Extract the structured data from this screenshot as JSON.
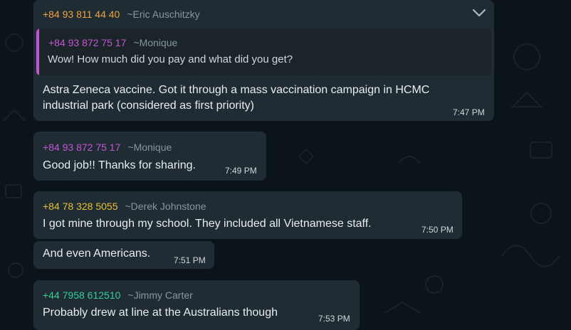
{
  "colors": {
    "background": "#0b141a",
    "bubble": "#202c33",
    "orange": "#f0a23c",
    "purple": "#c455d4",
    "yellow": "#e6c12e",
    "teal": "#35cd96",
    "muted": "#8696a0"
  },
  "messages": [
    {
      "phone": "+84 93 811 44 40",
      "name": "~Eric Auschitzky",
      "quote": {
        "phone": "+84 93 872 75 17",
        "name": "~Monique",
        "text": "Wow! How much did you pay and what did you get?"
      },
      "lines": [
        "Astra Zeneca vaccine. Got it through a mass vaccination campaign in HCMC",
        "industrial park (considered as first priority)"
      ],
      "time": "7:47 PM"
    },
    {
      "phone": "+84 93 872 75 17",
      "name": "~Monique",
      "text": "Good job!! Thanks for sharing.",
      "time": "7:49 PM"
    },
    {
      "phone": "+84 78 328 5055",
      "name": "~Derek Johnstone",
      "text": "I got mine through my school. They included all Vietnamese staff.",
      "time": "7:50 PM"
    },
    {
      "text": "And even Americans.",
      "time": "7:51 PM"
    },
    {
      "phone": "+44 7958 612510",
      "name": "~Jimmy Carter",
      "text": "Probably drew at line at the Australians though",
      "time": "7:53 PM"
    }
  ],
  "icons": {
    "menu": "chevron-down-icon"
  }
}
